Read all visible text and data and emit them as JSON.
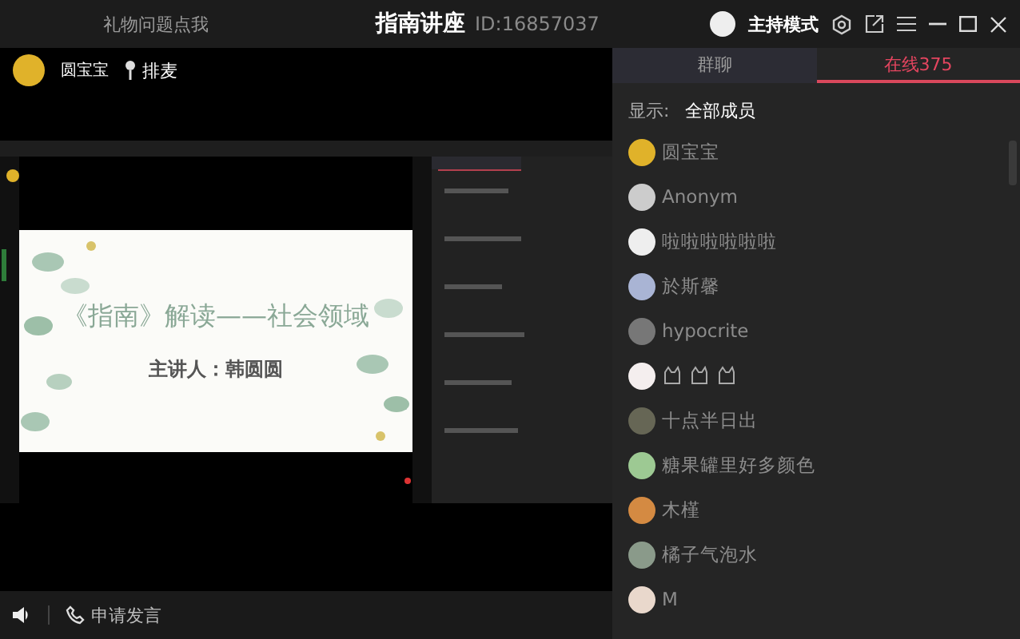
{
  "top_bar": {
    "help_link": "礼物问题点我",
    "title": "指南讲座",
    "room_id": "ID:16857037",
    "mode": "主持模式"
  },
  "host": {
    "name": "圆宝宝",
    "queue_button": "排麦"
  },
  "slide": {
    "title": "《指南》解读——社会领域",
    "presenter": "主讲人：韩圆圆"
  },
  "bottom_bar": {
    "apply_button": "申请发言"
  },
  "tabs": [
    {
      "label": "群聊",
      "selected": false
    },
    {
      "label": "在线375",
      "selected": true
    }
  ],
  "filter": {
    "label": "显示:",
    "value": "全部成员"
  },
  "members": [
    {
      "kind": "text",
      "name": "圆宝宝"
    },
    {
      "kind": "text",
      "name": "Anonym"
    },
    {
      "kind": "text",
      "name": "啦啦啦啦啦啦"
    },
    {
      "kind": "text",
      "name": "於斯馨"
    },
    {
      "kind": "text",
      "name": "hypocrite"
    },
    {
      "kind": "icons"
    },
    {
      "kind": "text",
      "name": "十点半日出"
    },
    {
      "kind": "text",
      "name": "糖果罐里好多颜色"
    },
    {
      "kind": "text",
      "name": "木槿"
    },
    {
      "kind": "text",
      "name": "橘子气泡水"
    },
    {
      "kind": "text",
      "name": "M"
    }
  ]
}
